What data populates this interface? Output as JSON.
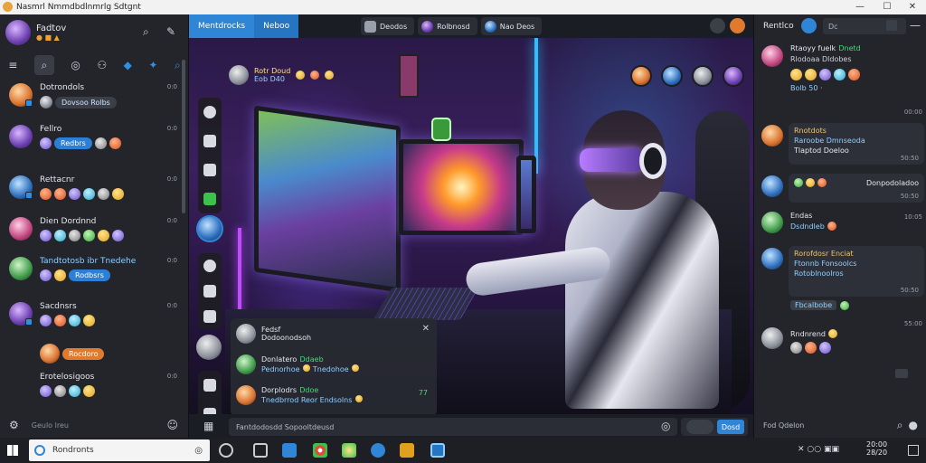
{
  "window": {
    "title": "Nasmrl Nmmdbdlnmrlg Sdtgnt",
    "controls": [
      "—",
      "☐",
      "✕"
    ]
  },
  "left_panel": {
    "user_name": "Fadtov",
    "user_status": "● ■ ▲",
    "footer_placeholder": "Geulo lreu",
    "conversations": [
      {
        "name": "Dotrondols",
        "time": "0:0",
        "preview": "Dovsoo Rolbs",
        "style": "dark",
        "avatar": "orange"
      },
      {
        "name": "Fellro",
        "time": "0:0",
        "preview": "Redbrs",
        "style": "blue",
        "avatar": "purple"
      },
      {
        "name": "Rettacnr",
        "time": "0:0",
        "preview": "",
        "style": "emoji",
        "avatar": "blue"
      },
      {
        "name": "Dien Dordnnd",
        "time": "0:0",
        "preview": "",
        "style": "emoji",
        "avatar": "pink"
      },
      {
        "name": "Tandtotosb ibr Tnedehe",
        "time": "0:0",
        "preview": "Rodbsrs",
        "style": "blue",
        "avatar": "green"
      },
      {
        "name": "Sacdnsrs",
        "time": "0:0",
        "preview": "",
        "style": "emoji",
        "avatar": "purple"
      },
      {
        "name": "",
        "time": "",
        "preview": "Rocdoro",
        "style": "orange",
        "avatar": "orange"
      },
      {
        "name": "Erotelosigoos",
        "time": "0:0",
        "preview": "",
        "style": "emoji",
        "avatar": "grey"
      }
    ]
  },
  "center": {
    "tabs": [
      "Mentdrocks",
      "Neboo"
    ],
    "pills": [
      "Deodos",
      "Rolbnosd",
      "Nao Deos"
    ],
    "streamer": {
      "name": "Rotr Doud",
      "sub": "Eob D40"
    },
    "popup": {
      "header_name": "Fedsf",
      "header_sub": "Dodoonodsoh",
      "rows": [
        {
          "name": "Donlatero",
          "tag": "Ddaeb",
          "text": "Pednorhoe",
          "text2": "Tnedohoe"
        },
        {
          "name": "Dorplodrs",
          "tag": "Ddoe",
          "text": "Tnedbrrod Reor Endsolns",
          "text2": ""
        }
      ],
      "side_tag": "77"
    },
    "composer_placeholder": "Fantdodosdd Sopooltdeusd",
    "send_label": "Dosd"
  },
  "right_panel": {
    "title": "Rentlco",
    "search_placeholder": "Dc",
    "footer_placeholder": "Fod Qdelon",
    "messages": [
      {
        "name": "Rtaoyy fuelk",
        "tag": "Dnetd",
        "text": "Rlodoaa Dldobes",
        "time": "00:00",
        "extra": "Bolb 50 ·",
        "avatar": "pink"
      },
      {
        "name": "Rnotdots",
        "text": "Raroobe Dmnseoda",
        "text2": "Tlaptod Doeloo",
        "time": "50:50",
        "avatar": "orange"
      },
      {
        "name": "",
        "text": "Donpodoladoo",
        "time": "50:50",
        "avatar": "blue"
      },
      {
        "name": "Endas",
        "text": "Dsdndleb",
        "time": "10:05",
        "avatar": "green"
      },
      {
        "name": "Rorofdosr Enciat",
        "text": "Ftonnb Fonsoolcs",
        "text2": "Rotoblnoolros",
        "time": "50:50",
        "extra": "Fbcalbobe",
        "avatar": "blue"
      },
      {
        "name": "Rndnrend",
        "text": "",
        "time": "55:00",
        "avatar": "grey"
      }
    ]
  },
  "taskbar": {
    "search_text": "Rondronts",
    "clock_time": "20:00",
    "clock_date": "28/20"
  },
  "colors": {
    "accent": "#2f86d6",
    "sidebar_bg": "#23252b",
    "online": "#2e8fe6"
  }
}
